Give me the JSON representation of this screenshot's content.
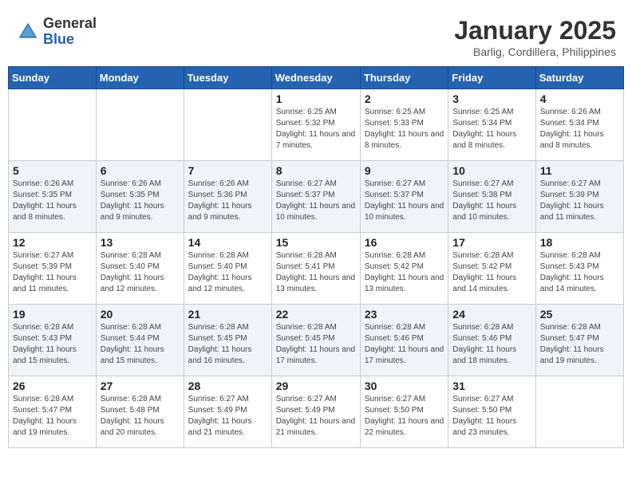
{
  "logo": {
    "general": "General",
    "blue": "Blue"
  },
  "title": {
    "month": "January 2025",
    "location": "Barlig, Cordillera, Philippines"
  },
  "days_of_week": [
    "Sunday",
    "Monday",
    "Tuesday",
    "Wednesday",
    "Thursday",
    "Friday",
    "Saturday"
  ],
  "weeks": [
    [
      {
        "day": "",
        "info": ""
      },
      {
        "day": "",
        "info": ""
      },
      {
        "day": "",
        "info": ""
      },
      {
        "day": "1",
        "info": "Sunrise: 6:25 AM\nSunset: 5:32 PM\nDaylight: 11 hours and 7 minutes."
      },
      {
        "day": "2",
        "info": "Sunrise: 6:25 AM\nSunset: 5:33 PM\nDaylight: 11 hours and 8 minutes."
      },
      {
        "day": "3",
        "info": "Sunrise: 6:25 AM\nSunset: 5:34 PM\nDaylight: 11 hours and 8 minutes."
      },
      {
        "day": "4",
        "info": "Sunrise: 6:26 AM\nSunset: 5:34 PM\nDaylight: 11 hours and 8 minutes."
      }
    ],
    [
      {
        "day": "5",
        "info": "Sunrise: 6:26 AM\nSunset: 5:35 PM\nDaylight: 11 hours and 8 minutes."
      },
      {
        "day": "6",
        "info": "Sunrise: 6:26 AM\nSunset: 5:35 PM\nDaylight: 11 hours and 9 minutes."
      },
      {
        "day": "7",
        "info": "Sunrise: 6:26 AM\nSunset: 5:36 PM\nDaylight: 11 hours and 9 minutes."
      },
      {
        "day": "8",
        "info": "Sunrise: 6:27 AM\nSunset: 5:37 PM\nDaylight: 11 hours and 10 minutes."
      },
      {
        "day": "9",
        "info": "Sunrise: 6:27 AM\nSunset: 5:37 PM\nDaylight: 11 hours and 10 minutes."
      },
      {
        "day": "10",
        "info": "Sunrise: 6:27 AM\nSunset: 5:38 PM\nDaylight: 11 hours and 10 minutes."
      },
      {
        "day": "11",
        "info": "Sunrise: 6:27 AM\nSunset: 5:39 PM\nDaylight: 11 hours and 11 minutes."
      }
    ],
    [
      {
        "day": "12",
        "info": "Sunrise: 6:27 AM\nSunset: 5:39 PM\nDaylight: 11 hours and 11 minutes."
      },
      {
        "day": "13",
        "info": "Sunrise: 6:28 AM\nSunset: 5:40 PM\nDaylight: 11 hours and 12 minutes."
      },
      {
        "day": "14",
        "info": "Sunrise: 6:28 AM\nSunset: 5:40 PM\nDaylight: 11 hours and 12 minutes."
      },
      {
        "day": "15",
        "info": "Sunrise: 6:28 AM\nSunset: 5:41 PM\nDaylight: 11 hours and 13 minutes."
      },
      {
        "day": "16",
        "info": "Sunrise: 6:28 AM\nSunset: 5:42 PM\nDaylight: 11 hours and 13 minutes."
      },
      {
        "day": "17",
        "info": "Sunrise: 6:28 AM\nSunset: 5:42 PM\nDaylight: 11 hours and 14 minutes."
      },
      {
        "day": "18",
        "info": "Sunrise: 6:28 AM\nSunset: 5:43 PM\nDaylight: 11 hours and 14 minutes."
      }
    ],
    [
      {
        "day": "19",
        "info": "Sunrise: 6:28 AM\nSunset: 5:43 PM\nDaylight: 11 hours and 15 minutes."
      },
      {
        "day": "20",
        "info": "Sunrise: 6:28 AM\nSunset: 5:44 PM\nDaylight: 11 hours and 15 minutes."
      },
      {
        "day": "21",
        "info": "Sunrise: 6:28 AM\nSunset: 5:45 PM\nDaylight: 11 hours and 16 minutes."
      },
      {
        "day": "22",
        "info": "Sunrise: 6:28 AM\nSunset: 5:45 PM\nDaylight: 11 hours and 17 minutes."
      },
      {
        "day": "23",
        "info": "Sunrise: 6:28 AM\nSunset: 5:46 PM\nDaylight: 11 hours and 17 minutes."
      },
      {
        "day": "24",
        "info": "Sunrise: 6:28 AM\nSunset: 5:46 PM\nDaylight: 11 hours and 18 minutes."
      },
      {
        "day": "25",
        "info": "Sunrise: 6:28 AM\nSunset: 5:47 PM\nDaylight: 11 hours and 19 minutes."
      }
    ],
    [
      {
        "day": "26",
        "info": "Sunrise: 6:28 AM\nSunset: 5:47 PM\nDaylight: 11 hours and 19 minutes."
      },
      {
        "day": "27",
        "info": "Sunrise: 6:28 AM\nSunset: 5:48 PM\nDaylight: 11 hours and 20 minutes."
      },
      {
        "day": "28",
        "info": "Sunrise: 6:27 AM\nSunset: 5:49 PM\nDaylight: 11 hours and 21 minutes."
      },
      {
        "day": "29",
        "info": "Sunrise: 6:27 AM\nSunset: 5:49 PM\nDaylight: 11 hours and 21 minutes."
      },
      {
        "day": "30",
        "info": "Sunrise: 6:27 AM\nSunset: 5:50 PM\nDaylight: 11 hours and 22 minutes."
      },
      {
        "day": "31",
        "info": "Sunrise: 6:27 AM\nSunset: 5:50 PM\nDaylight: 11 hours and 23 minutes."
      },
      {
        "day": "",
        "info": ""
      }
    ]
  ]
}
